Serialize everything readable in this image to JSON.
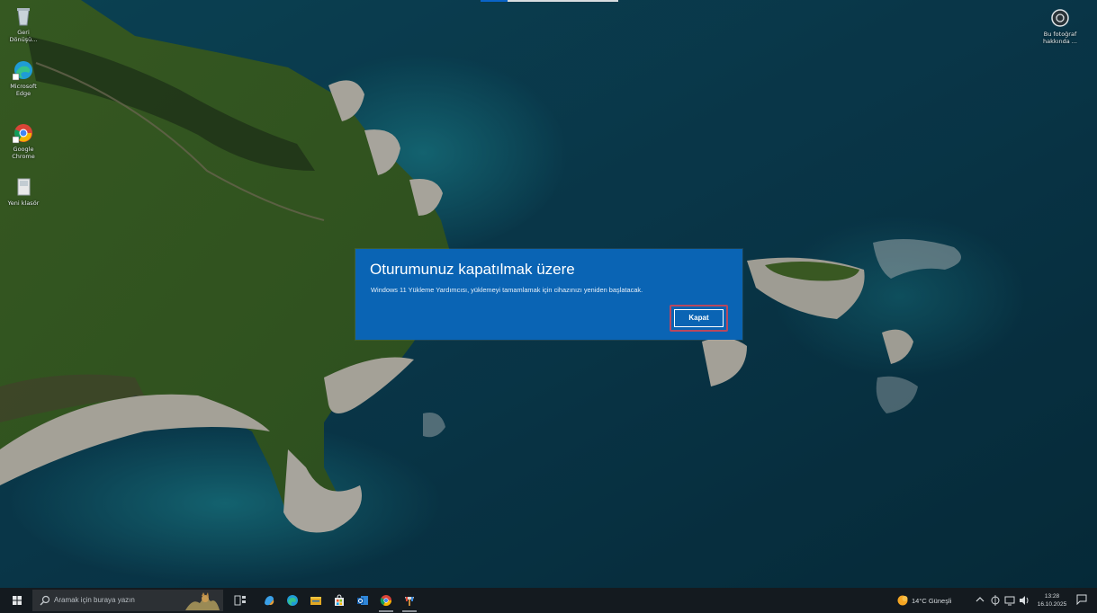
{
  "desktop": {
    "icons": [
      {
        "label": "Geri\nDönüşü...",
        "name": "recycle-bin"
      },
      {
        "label": "Microsoft\nEdge",
        "name": "microsoft-edge"
      },
      {
        "label": "Google\nChrome",
        "name": "google-chrome"
      },
      {
        "label": "Yeni klasör",
        "name": "new-folder"
      }
    ],
    "about_photo": {
      "label": "Bu fotoğraf\nhakkında ...",
      "icon": "camera-icon"
    }
  },
  "dialog": {
    "title": "Oturumunuz kapatılmak üzere",
    "message": "Windows 11 Yükleme Yardımcısı, yüklemeyi tamamlamak için cihazınızı yeniden başlatacak.",
    "button_label": "Kapat",
    "background_color": "#0a64b4",
    "highlight_color": "#b8475e"
  },
  "taskbar": {
    "search_placeholder": "Aramak için buraya yazın",
    "apps": [
      "task-view-icon",
      "copilot-icon",
      "edge-icon",
      "file-explorer-icon",
      "store-icon",
      "outlook-icon",
      "chrome-icon",
      "paint-icon"
    ],
    "weather": {
      "text": "14°C  Güneşli",
      "icon": "sun-icon"
    },
    "tray_icons": [
      "chevron-up-icon",
      "network-icon",
      "display-icon",
      "volume-icon"
    ],
    "clock": {
      "time": "13:28",
      "date": "16.10.2025"
    }
  }
}
